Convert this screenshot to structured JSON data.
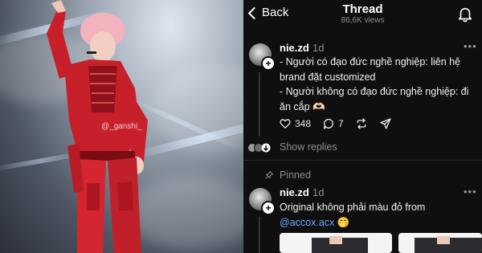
{
  "photo": {
    "watermark": "@_ganshi_"
  },
  "header": {
    "back_label": "Back",
    "title": "Thread",
    "views": "86,6K views"
  },
  "post1": {
    "username": "nie.zd",
    "time": "1d",
    "lines": [
      "- Người có đạo đức nghề nghiệp: liên hệ",
      "brand đặt customized",
      "- Người không có đạo đức nghề nghiệp: đi",
      "ăn cắp 🫶🏻"
    ],
    "likes": "348",
    "comments": "7",
    "show_replies": "Show replies"
  },
  "post2": {
    "pinned_label": "Pinned",
    "username": "nie.zd",
    "time": "1d",
    "text": "Original không phải màu đỏ from",
    "mention": "@accox.acx",
    "emoji": "🤭"
  },
  "colors": {
    "background": "#0f0f0f",
    "text": "#f2f2f2",
    "muted": "#8d8d8d",
    "link": "#6da8ff",
    "photo_red": "#c8202a"
  },
  "icons": [
    "back-chevron-icon",
    "bell-icon",
    "heart-icon",
    "comment-icon",
    "repost-icon",
    "share-icon",
    "pin-icon",
    "more-icon"
  ]
}
